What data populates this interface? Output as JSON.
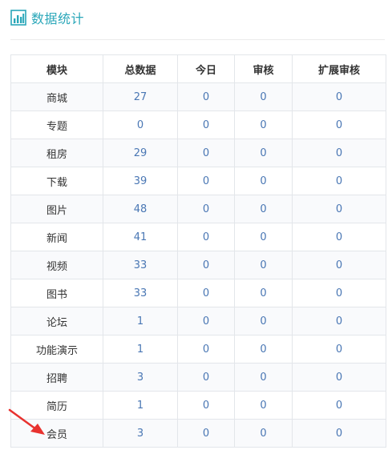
{
  "header": {
    "icon": "bar-chart-icon",
    "title": "数据统计",
    "accent_color": "#2aa7b9"
  },
  "table": {
    "columns": [
      "模块",
      "总数据",
      "今日",
      "审核",
      "扩展审核"
    ],
    "rows": [
      {
        "module": "商城",
        "total": "27",
        "today": "0",
        "review": "0",
        "ext_review": "0"
      },
      {
        "module": "专题",
        "total": "0",
        "today": "0",
        "review": "0",
        "ext_review": "0"
      },
      {
        "module": "租房",
        "total": "29",
        "today": "0",
        "review": "0",
        "ext_review": "0"
      },
      {
        "module": "下载",
        "total": "39",
        "today": "0",
        "review": "0",
        "ext_review": "0"
      },
      {
        "module": "图片",
        "total": "48",
        "today": "0",
        "review": "0",
        "ext_review": "0"
      },
      {
        "module": "新闻",
        "total": "41",
        "today": "0",
        "review": "0",
        "ext_review": "0"
      },
      {
        "module": "视频",
        "total": "33",
        "today": "0",
        "review": "0",
        "ext_review": "0"
      },
      {
        "module": "图书",
        "total": "33",
        "today": "0",
        "review": "0",
        "ext_review": "0"
      },
      {
        "module": "论坛",
        "total": "1",
        "today": "0",
        "review": "0",
        "ext_review": "0"
      },
      {
        "module": "功能演示",
        "total": "1",
        "today": "0",
        "review": "0",
        "ext_review": "0"
      },
      {
        "module": "招聘",
        "total": "3",
        "today": "0",
        "review": "0",
        "ext_review": "0"
      },
      {
        "module": "简历",
        "total": "1",
        "today": "0",
        "review": "0",
        "ext_review": "0"
      },
      {
        "module": "会员",
        "total": "3",
        "today": "0",
        "review": "0",
        "ext_review": "0"
      }
    ]
  },
  "annotation": {
    "icon": "red-arrow-icon",
    "color": "#e8322f"
  }
}
